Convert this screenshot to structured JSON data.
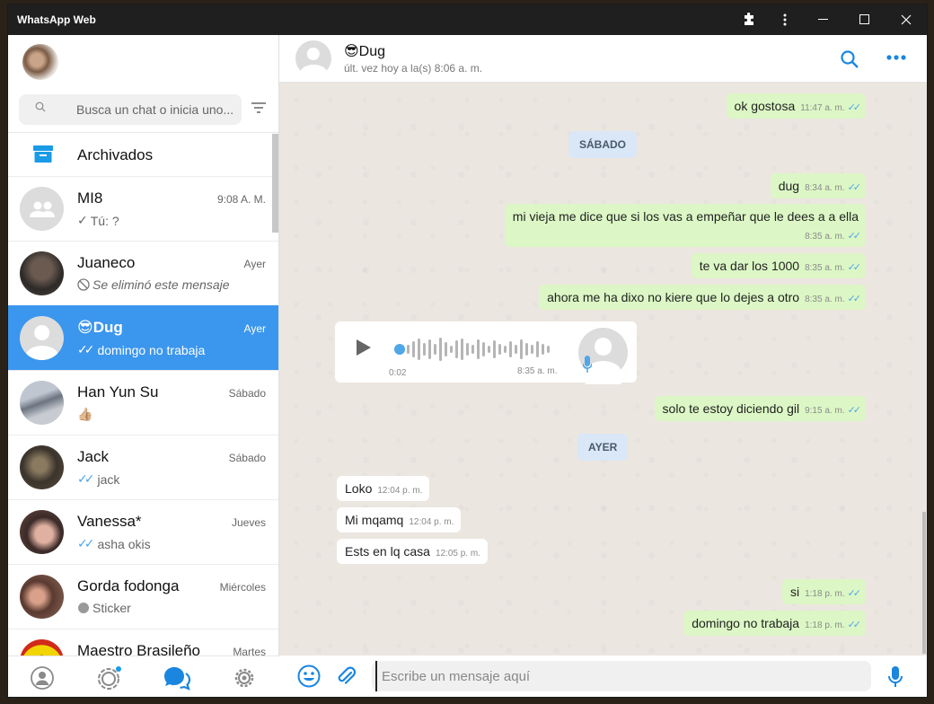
{
  "window": {
    "title": "WhatsApp Web"
  },
  "sidebar": {
    "search_placeholder": "Busca un chat o inicia uno...",
    "archived_label": "Archivados",
    "chats": [
      {
        "name": "MI8",
        "time": "9:08 A. M.",
        "preview": "Tú: ?",
        "status": "sent-tick",
        "avatar": "group-icon"
      },
      {
        "name": "Juaneco",
        "time": "Ayer",
        "preview": "Se eliminó este mensaje",
        "status": "deleted-icon",
        "avatar": "photo"
      },
      {
        "name": "😎Dug",
        "time": "Ayer",
        "preview": "domingo no trabaja",
        "status": "read-ticks",
        "avatar": "default",
        "active": true
      },
      {
        "name": "Han Yun Su",
        "time": "Sábado",
        "preview": "👍🏼",
        "status": "",
        "avatar": "photo"
      },
      {
        "name": "Jack",
        "time": "Sábado",
        "preview": "jack",
        "status": "read-ticks",
        "avatar": "photo"
      },
      {
        "name": "Vanessa*",
        "time": "Jueves",
        "preview": "asha okis",
        "status": "read-ticks",
        "avatar": "photo"
      },
      {
        "name": "Gorda fodonga",
        "time": "Miércoles",
        "preview": "Sticker",
        "status": "sticker-icon",
        "avatar": "photo"
      },
      {
        "name": "Maestro Brasileño",
        "time": "Martes",
        "preview": "",
        "status": "",
        "avatar": "photo"
      }
    ]
  },
  "conversation": {
    "contact_name": "😎Dug",
    "last_seen": "últ. vez hoy a la(s) 8:06 a. m.",
    "messages": [
      {
        "dir": "out",
        "text": "ok gostosa",
        "time": "11:47 a. m."
      },
      {
        "type": "date",
        "text": "SÁBADO"
      },
      {
        "dir": "out",
        "text": "dug",
        "time": "8:34 a. m."
      },
      {
        "dir": "out",
        "text": "mi vieja me dice que si los vas a empeñar que le dees a a ella",
        "time": "8:35 a. m."
      },
      {
        "dir": "out",
        "text": "te va dar los 1000",
        "time": "8:35 a. m."
      },
      {
        "dir": "out",
        "text": "ahora me ha dixo no kiere que lo dejes a otro",
        "time": "8:35 a. m."
      },
      {
        "dir": "in",
        "type": "voice",
        "duration": "0:02",
        "time": "8:35 a. m."
      },
      {
        "dir": "out",
        "text": "solo te estoy diciendo gil",
        "time": "9:15 a. m."
      },
      {
        "type": "date",
        "text": "AYER"
      },
      {
        "dir": "in",
        "text": "Loko",
        "time": "12:04 p. m."
      },
      {
        "dir": "in",
        "text": "Mi mqamq",
        "time": "12:04 p. m."
      },
      {
        "dir": "in",
        "text": "Ests en lq casa",
        "time": "12:05 p. m."
      },
      {
        "dir": "out",
        "text": "si",
        "time": "1:18 p. m."
      },
      {
        "dir": "out",
        "text": "domingo no trabaja",
        "time": "1:18 p. m."
      }
    ]
  },
  "composer": {
    "placeholder": "Escribe un mensaje aquí"
  },
  "colors": {
    "accent": "#3b96ee",
    "outgoing_bubble": "#dcf7c5",
    "read_tick": "#4fa6e8",
    "chat_bg": "#ebe6e0"
  }
}
